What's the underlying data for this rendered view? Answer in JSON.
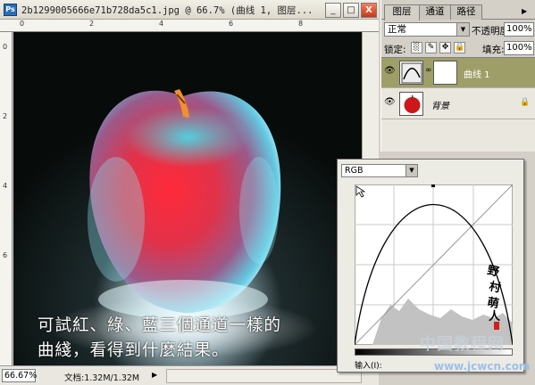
{
  "window": {
    "title": "2b1299005666e71b728da5c1.jpg @ 66.7% (曲线 1, 图层...",
    "app_icon": "Ps",
    "minimize": "_",
    "maximize": "□",
    "close": "X"
  },
  "ruler": {
    "top_numbers": [
      "0",
      "2",
      "4",
      "6",
      "8"
    ],
    "left_numbers": [
      "0",
      "2",
      "4",
      "6"
    ]
  },
  "caption": {
    "line1": "可試紅、綠、藍三個通道一樣的",
    "line2": "曲綫，看得到什麼結果。"
  },
  "status": {
    "zoom": "66.67%",
    "doc_info": "文档:1.32M/1.32M",
    "arrow": "▶"
  },
  "layers_panel": {
    "tabs": [
      "图层",
      "通道",
      "路径"
    ],
    "blend_mode": "正常",
    "opacity_label": "不透明度:",
    "opacity": "100%",
    "lock_label": "锁定:",
    "fill_label": "填充:",
    "fill": "100%",
    "layers": [
      {
        "name": "曲线 1",
        "type": "adjustment",
        "selected": true
      },
      {
        "name": "背景",
        "type": "image",
        "locked": true
      }
    ],
    "accent_color": "#9e9f68"
  },
  "curves": {
    "channel": "RGB",
    "input_label": "输入(I):",
    "icons": [
      "pointer-icon"
    ]
  },
  "watermark": {
    "text": "中国教程网",
    "site": "www.jcwcn.com"
  }
}
